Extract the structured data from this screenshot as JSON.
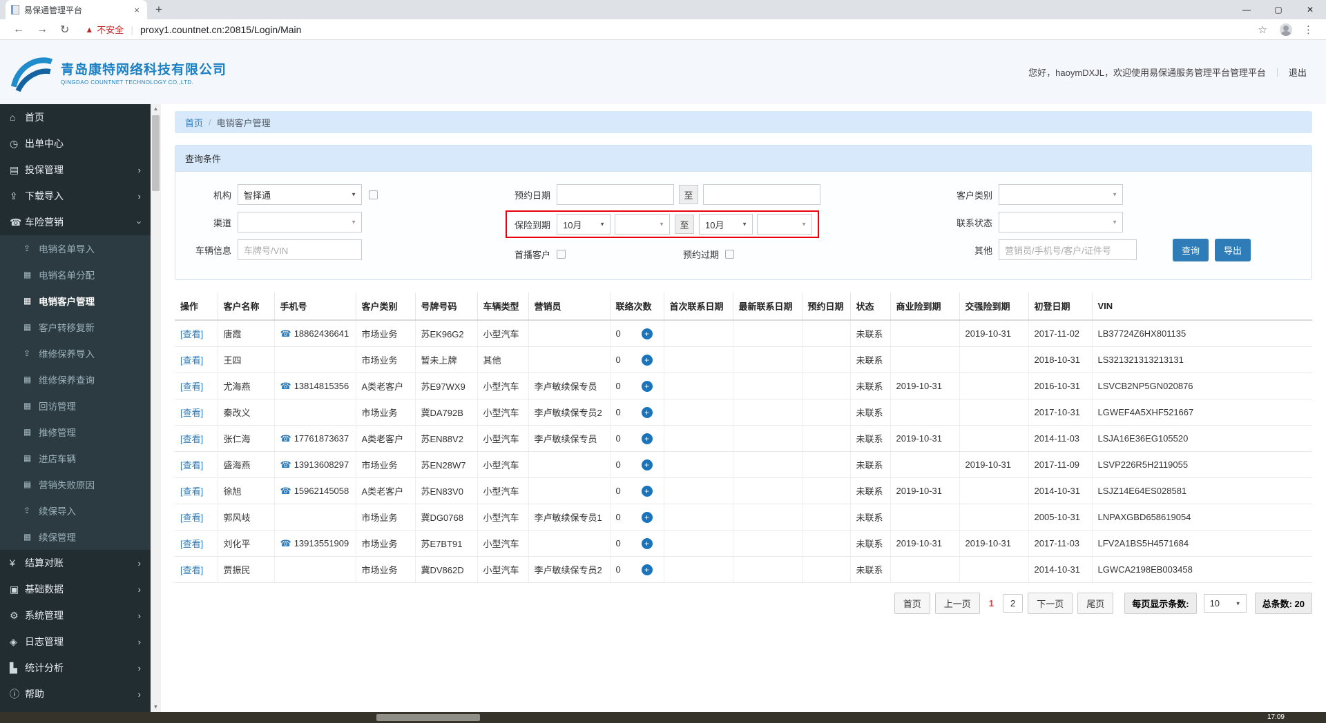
{
  "browser": {
    "tab_title": "易保通管理平台",
    "security_warning": "不安全",
    "url": "proxy1.countnet.cn:20815/Login/Main"
  },
  "header": {
    "company_cn": "青岛康特网络科技有限公司",
    "company_en": "QINGDAO COUNTNET TECHNOLOGY CO.,LTD.",
    "greeting": "您好，haoymDXJL，欢迎使用易保通服务管理平台管理平台",
    "logout": "退出"
  },
  "sidebar": {
    "items": [
      {
        "label": "首页",
        "icon": "home-icon",
        "glyph": "⌂",
        "level": 1
      },
      {
        "label": "出单中心",
        "icon": "clock-icon",
        "glyph": "◷",
        "level": 1
      },
      {
        "label": "投保管理",
        "icon": "document-icon",
        "glyph": "▤",
        "level": 1,
        "chevron": "right"
      },
      {
        "label": "下载导入",
        "icon": "upload-icon",
        "glyph": "⇪",
        "level": 1,
        "chevron": "right"
      },
      {
        "label": "车险营销",
        "icon": "phone-icon",
        "glyph": "☎",
        "level": 1,
        "chevron": "down"
      },
      {
        "label": "电销名单导入",
        "icon": "upload-icon",
        "glyph": "⇪",
        "level": 2
      },
      {
        "label": "电销名单分配",
        "icon": "grid-icon",
        "glyph": "▦",
        "level": 2
      },
      {
        "label": "电销客户管理",
        "icon": "grid-icon",
        "glyph": "▦",
        "level": 2,
        "active": true
      },
      {
        "label": "客户转移复新",
        "icon": "grid-icon",
        "glyph": "▦",
        "level": 2
      },
      {
        "label": "维修保养导入",
        "icon": "upload-icon",
        "glyph": "⇪",
        "level": 2
      },
      {
        "label": "维修保养查询",
        "icon": "grid-icon",
        "glyph": "▦",
        "level": 2
      },
      {
        "label": "回访管理",
        "icon": "grid-icon",
        "glyph": "▦",
        "level": 2
      },
      {
        "label": "推修管理",
        "icon": "grid-icon",
        "glyph": "▦",
        "level": 2
      },
      {
        "label": "进店车辆",
        "icon": "grid-icon",
        "glyph": "▦",
        "level": 2
      },
      {
        "label": "营销失败原因",
        "icon": "grid-icon",
        "glyph": "▦",
        "level": 2
      },
      {
        "label": "续保导入",
        "icon": "upload-icon",
        "glyph": "⇪",
        "level": 2
      },
      {
        "label": "续保管理",
        "icon": "grid-icon",
        "glyph": "▦",
        "level": 2
      },
      {
        "label": "结算对账",
        "icon": "yen-icon",
        "glyph": "¥",
        "level": 1,
        "chevron": "right"
      },
      {
        "label": "基础数据",
        "icon": "database-icon",
        "glyph": "▣",
        "level": 1,
        "chevron": "right"
      },
      {
        "label": "系统管理",
        "icon": "gear-icon",
        "glyph": "⚙",
        "level": 1,
        "chevron": "right"
      },
      {
        "label": "日志管理",
        "icon": "tag-icon",
        "glyph": "◈",
        "level": 1,
        "chevron": "right"
      },
      {
        "label": "统计分析",
        "icon": "chart-icon",
        "glyph": "▙",
        "level": 1,
        "chevron": "right"
      },
      {
        "label": "帮助",
        "icon": "info-icon",
        "glyph": "ⓘ",
        "level": 1,
        "chevron": "right"
      }
    ]
  },
  "breadcrumb": {
    "home": "首页",
    "separator": "/",
    "current": "电销客户管理"
  },
  "query": {
    "title": "查询条件",
    "org_label": "机构",
    "org_value": "智择通",
    "channel_label": "渠道",
    "vehicle_label": "车辆信息",
    "vehicle_placeholder": "车牌号/VIN",
    "appoint_label": "预约日期",
    "to_label": "至",
    "insurance_label": "保险到期",
    "month_from": "10月",
    "month_to": "10月",
    "first_call_label": "首播客户",
    "appoint_expired_label": "预约过期",
    "customer_type_label": "客户类别",
    "contact_status_label": "联系状态",
    "other_label": "其他",
    "other_placeholder": "营销员/手机号/客户/证件号",
    "search_button": "查询",
    "export_button": "导出"
  },
  "table": {
    "view_label": "[查看]",
    "columns": [
      "操作",
      "客户名称",
      "手机号",
      "客户类别",
      "号牌号码",
      "车辆类型",
      "营销员",
      "联络次数",
      "首次联系日期",
      "最新联系日期",
      "预约日期",
      "状态",
      "商业险到期",
      "交强险到期",
      "初登日期",
      "VIN"
    ],
    "rows": [
      {
        "name": "唐霞",
        "phone": "18862436641",
        "type": "市场业务",
        "plate": "苏EK96G2",
        "vehicle": "小型汽车",
        "agent": "",
        "contacts": "0",
        "first_date": "",
        "last_date": "",
        "appoint": "",
        "status": "未联系",
        "biz_expire": "",
        "force_expire": "2019-10-31",
        "reg_date": "2017-11-02",
        "vin": "LB37724Z6HX801135"
      },
      {
        "name": "王四",
        "phone": "",
        "type": "市场业务",
        "plate": "暂未上牌",
        "vehicle": "其他",
        "agent": "",
        "contacts": "0",
        "first_date": "",
        "last_date": "",
        "appoint": "",
        "status": "未联系",
        "biz_expire": "",
        "force_expire": "",
        "reg_date": "2018-10-31",
        "vin": "LS321321313213131"
      },
      {
        "name": "尤海燕",
        "phone": "13814815356",
        "type": "A类老客户",
        "plate": "苏E97WX9",
        "vehicle": "小型汽车",
        "agent": "李卢敏续保专员",
        "contacts": "0",
        "first_date": "",
        "last_date": "",
        "appoint": "",
        "status": "未联系",
        "biz_expire": "2019-10-31",
        "force_expire": "",
        "reg_date": "2016-10-31",
        "vin": "LSVCB2NP5GN020876"
      },
      {
        "name": "秦改义",
        "phone": "",
        "type": "市场业务",
        "plate": "冀DA792B",
        "vehicle": "小型汽车",
        "agent": "李卢敏续保专员2",
        "contacts": "0",
        "first_date": "",
        "last_date": "",
        "appoint": "",
        "status": "未联系",
        "biz_expire": "",
        "force_expire": "",
        "reg_date": "2017-10-31",
        "vin": "LGWEF4A5XHF521667"
      },
      {
        "name": "张仁海",
        "phone": "17761873637",
        "type": "A类老客户",
        "plate": "苏EN88V2",
        "vehicle": "小型汽车",
        "agent": "李卢敏续保专员",
        "contacts": "0",
        "first_date": "",
        "last_date": "",
        "appoint": "",
        "status": "未联系",
        "biz_expire": "2019-10-31",
        "force_expire": "",
        "reg_date": "2014-11-03",
        "vin": "LSJA16E36EG105520"
      },
      {
        "name": "盛海燕",
        "phone": "13913608297",
        "type": "市场业务",
        "plate": "苏EN28W7",
        "vehicle": "小型汽车",
        "agent": "",
        "contacts": "0",
        "first_date": "",
        "last_date": "",
        "appoint": "",
        "status": "未联系",
        "biz_expire": "",
        "force_expire": "2019-10-31",
        "reg_date": "2017-11-09",
        "vin": "LSVP226R5H2119055"
      },
      {
        "name": "徐旭",
        "phone": "15962145058",
        "type": "A类老客户",
        "plate": "苏EN83V0",
        "vehicle": "小型汽车",
        "agent": "",
        "contacts": "0",
        "first_date": "",
        "last_date": "",
        "appoint": "",
        "status": "未联系",
        "biz_expire": "2019-10-31",
        "force_expire": "",
        "reg_date": "2014-10-31",
        "vin": "LSJZ14E64ES028581"
      },
      {
        "name": "郭风岐",
        "phone": "",
        "type": "市场业务",
        "plate": "冀DG0768",
        "vehicle": "小型汽车",
        "agent": "李卢敏续保专员1",
        "contacts": "0",
        "first_date": "",
        "last_date": "",
        "appoint": "",
        "status": "未联系",
        "biz_expire": "",
        "force_expire": "",
        "reg_date": "2005-10-31",
        "vin": "LNPAXGBD658619054"
      },
      {
        "name": "刘化平",
        "phone": "13913551909",
        "type": "市场业务",
        "plate": "苏E7BT91",
        "vehicle": "小型汽车",
        "agent": "",
        "contacts": "0",
        "first_date": "",
        "last_date": "",
        "appoint": "",
        "status": "未联系",
        "biz_expire": "2019-10-31",
        "force_expire": "2019-10-31",
        "reg_date": "2017-11-03",
        "vin": "LFV2A1BS5H4571684"
      },
      {
        "name": "贾振民",
        "phone": "",
        "type": "市场业务",
        "plate": "冀DV862D",
        "vehicle": "小型汽车",
        "agent": "李卢敏续保专员2",
        "contacts": "0",
        "first_date": "",
        "last_date": "",
        "appoint": "",
        "status": "未联系",
        "biz_expire": "",
        "force_expire": "",
        "reg_date": "2014-10-31",
        "vin": "LGWCA2198EB003458"
      }
    ]
  },
  "pagination": {
    "first": "首页",
    "prev": "上一页",
    "pages": [
      "1",
      "2"
    ],
    "current": "1",
    "next": "下一页",
    "last": "尾页",
    "page_size_label": "每页显示条数:",
    "page_size": "10",
    "total_label": "总条数:",
    "total_value": "20"
  },
  "status_bar": {
    "clock": "17:09"
  },
  "colors": {
    "accent": "#2e7cb8",
    "sidebar_bg": "#222d32",
    "highlight_red": "#e8000d",
    "panel_blue": "#d8e9fb"
  }
}
